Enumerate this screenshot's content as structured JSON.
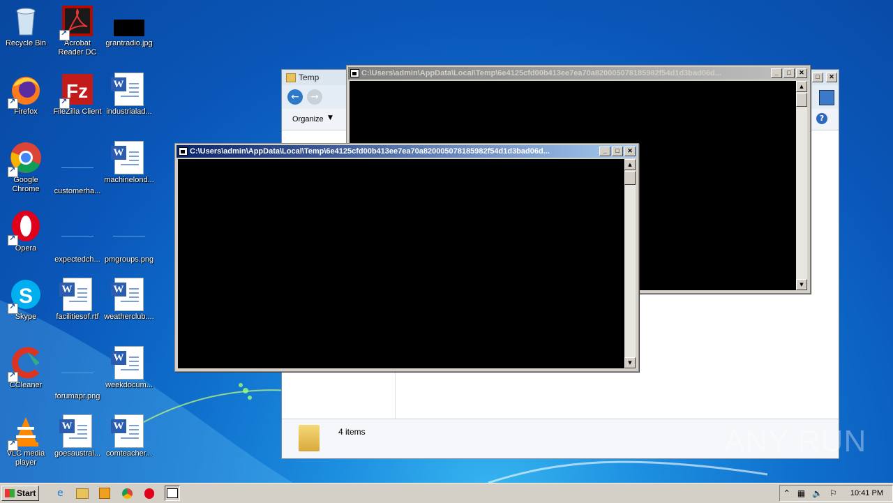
{
  "desktop": {
    "icons": [
      {
        "label": "Recycle Bin",
        "icon": "recycle-bin-icon"
      },
      {
        "label": "Acrobat Reader DC",
        "icon": "acrobat-icon"
      },
      {
        "label": "grantradio.jpg",
        "icon": "image-file-icon"
      },
      {
        "label": "Firefox",
        "icon": "firefox-icon"
      },
      {
        "label": "FileZilla Client",
        "icon": "filezilla-icon"
      },
      {
        "label": "industrialad...",
        "icon": "word-doc-icon"
      },
      {
        "label": "Google Chrome",
        "icon": "chrome-icon"
      },
      {
        "label": "customerha...",
        "icon": "blank-file-icon"
      },
      {
        "label": "machinelond...",
        "icon": "word-doc-icon"
      },
      {
        "label": "Opera",
        "icon": "opera-icon"
      },
      {
        "label": "expectedch...",
        "icon": "blank-file-icon"
      },
      {
        "label": "pmgroups.png",
        "icon": "blank-file-icon"
      },
      {
        "label": "Skype",
        "icon": "skype-icon"
      },
      {
        "label": "facilitiesof.rtf",
        "icon": "word-doc-icon"
      },
      {
        "label": "weatherclub....",
        "icon": "word-doc-icon"
      },
      {
        "label": "CCleaner",
        "icon": "ccleaner-icon"
      },
      {
        "label": "forumapr.png",
        "icon": "blank-file-icon"
      },
      {
        "label": "weekdocum...",
        "icon": "word-doc-icon"
      },
      {
        "label": "VLC media player",
        "icon": "vlc-icon"
      },
      {
        "label": "goesaustral...",
        "icon": "word-doc-icon"
      },
      {
        "label": "comteacher...",
        "icon": "word-doc-icon"
      }
    ]
  },
  "explorer": {
    "title": "Temp",
    "organize": "Organize",
    "status": "4 items"
  },
  "console_back": {
    "title": "C:\\Users\\admin\\AppData\\Local\\Temp\\6e4125cfd00b413ee7ea70a820005078185982f54d1d3bad06d..."
  },
  "console_front": {
    "title": "C:\\Users\\admin\\AppData\\Local\\Temp\\6e4125cfd00b413ee7ea70a820005078185982f54d1d3bad06d..."
  },
  "taskbar": {
    "start": "Start",
    "clock": "10:41 PM"
  },
  "watermark": "ANY RUN",
  "colors": {
    "title_active": "#0a246a",
    "title_inactive": "#808080",
    "console_bg": "#000000"
  }
}
